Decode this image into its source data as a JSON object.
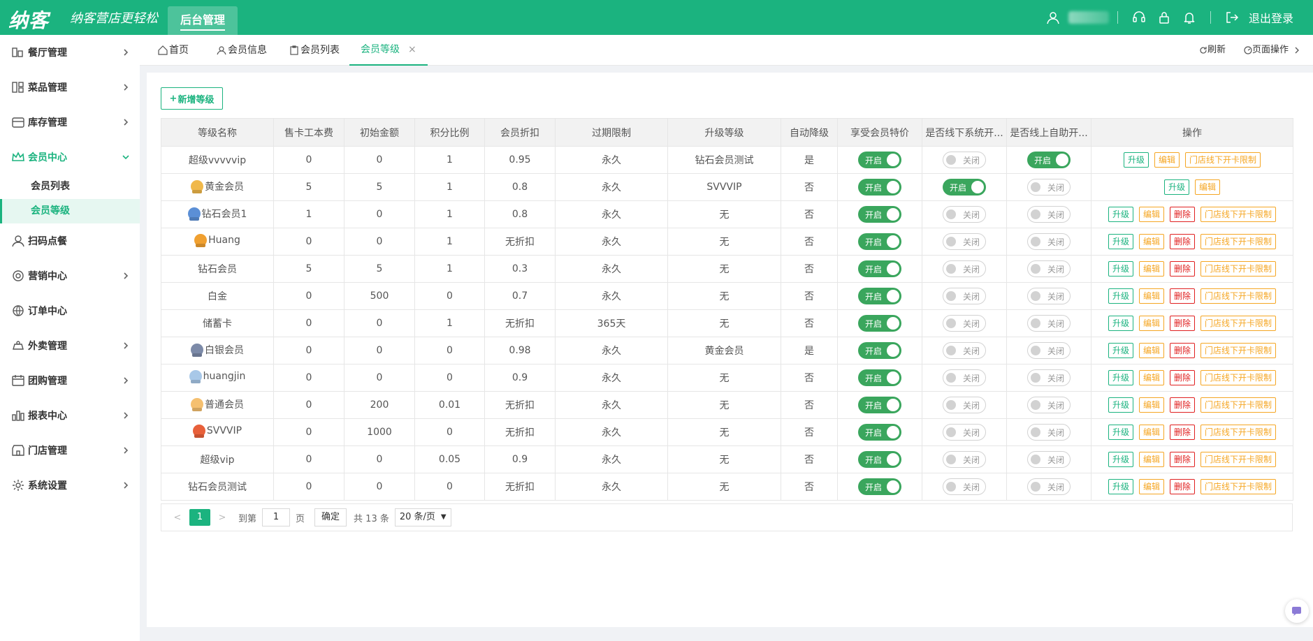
{
  "header": {
    "logo": "纳客",
    "slogan": "纳客营店更轻松",
    "backend_tab": "后台管理",
    "logout": "退出登录"
  },
  "sidebar": {
    "items": [
      {
        "label": "餐厅管理",
        "icon": "restaurant-icon",
        "has_arrow": true
      },
      {
        "label": "菜品管理",
        "icon": "dishes-icon",
        "has_arrow": true
      },
      {
        "label": "库存管理",
        "icon": "inventory-icon",
        "has_arrow": true
      },
      {
        "label": "会员中心",
        "icon": "crown-icon",
        "has_arrow": true,
        "expanded": true
      },
      {
        "label": "扫码点餐",
        "icon": "user-icon",
        "has_arrow": false
      },
      {
        "label": "营销中心",
        "icon": "target-icon",
        "has_arrow": true
      },
      {
        "label": "订单中心",
        "icon": "globe-icon",
        "has_arrow": false
      },
      {
        "label": "外卖管理",
        "icon": "takeout-icon",
        "has_arrow": true
      },
      {
        "label": "团购管理",
        "icon": "calendar-icon",
        "has_arrow": true
      },
      {
        "label": "报表中心",
        "icon": "report-icon",
        "has_arrow": true
      },
      {
        "label": "门店管理",
        "icon": "store-icon",
        "has_arrow": true
      },
      {
        "label": "系统设置",
        "icon": "gear-icon",
        "has_arrow": true
      }
    ],
    "sub_items": [
      {
        "label": "会员列表"
      },
      {
        "label": "会员等级"
      }
    ]
  },
  "tabs": {
    "items": [
      {
        "label": "首页",
        "icon": "home-icon"
      },
      {
        "label": "会员信息",
        "icon": "user-icon"
      },
      {
        "label": "会员列表",
        "icon": "clipboard-icon"
      },
      {
        "label": "会员等级",
        "icon": ""
      }
    ],
    "close_glyph": "×",
    "refresh": "刷新",
    "page_ops": "页面操作"
  },
  "toolbar": {
    "add_label": "新增等级"
  },
  "table": {
    "headers": [
      "等级名称",
      "售卡工本费",
      "初始金额",
      "积分比例",
      "会员折扣",
      "过期限制",
      "升级等级",
      "自动降级",
      "享受会员特价",
      "是否线下系统开...",
      "是否线上自助开...",
      "操作"
    ],
    "on_label": "开启",
    "off_label": "关闭",
    "actions": {
      "upgrade": "升级",
      "edit": "编辑",
      "delete": "删除",
      "limit": "门店线下开卡限制"
    },
    "rows": [
      {
        "name": "超级vvvvvip",
        "medal": "",
        "fee": "0",
        "init": "0",
        "ratio": "1",
        "discount": "0.95",
        "expire": "永久",
        "upgrade": "钻石会员测试",
        "downgrade": "是",
        "special": true,
        "offline": false,
        "online": true,
        "ops": [
          "upgrade",
          "edit",
          "limit"
        ]
      },
      {
        "name": "黄金会员",
        "medal": "#f0b84a",
        "fee": "5",
        "init": "5",
        "ratio": "1",
        "discount": "0.8",
        "expire": "永久",
        "upgrade": "SVVVIP",
        "downgrade": "否",
        "special": true,
        "offline": true,
        "online": false,
        "ops": [
          "upgrade",
          "edit"
        ]
      },
      {
        "name": "钻石会员1",
        "medal": "#5b8fd6",
        "fee": "1",
        "init": "0",
        "ratio": "1",
        "discount": "0.8",
        "expire": "永久",
        "upgrade": "无",
        "downgrade": "否",
        "special": true,
        "offline": false,
        "online": false,
        "ops": [
          "upgrade",
          "edit",
          "delete",
          "limit"
        ]
      },
      {
        "name": "Huang",
        "medal": "#f0a030",
        "fee": "0",
        "init": "0",
        "ratio": "1",
        "discount": "无折扣",
        "expire": "永久",
        "upgrade": "无",
        "downgrade": "否",
        "special": true,
        "offline": false,
        "online": false,
        "ops": [
          "upgrade",
          "edit",
          "delete",
          "limit"
        ]
      },
      {
        "name": "钻石会员",
        "medal": "",
        "fee": "5",
        "init": "5",
        "ratio": "1",
        "discount": "0.3",
        "expire": "永久",
        "upgrade": "无",
        "downgrade": "否",
        "special": true,
        "offline": false,
        "online": false,
        "ops": [
          "upgrade",
          "edit",
          "delete",
          "limit"
        ]
      },
      {
        "name": "白金",
        "medal": "",
        "fee": "0",
        "init": "500",
        "ratio": "0",
        "discount": "0.7",
        "expire": "永久",
        "upgrade": "无",
        "downgrade": "否",
        "special": true,
        "offline": false,
        "online": false,
        "ops": [
          "upgrade",
          "edit",
          "delete",
          "limit"
        ]
      },
      {
        "name": "储蓄卡",
        "medal": "",
        "fee": "0",
        "init": "0",
        "ratio": "1",
        "discount": "无折扣",
        "expire": "365天",
        "upgrade": "无",
        "downgrade": "否",
        "special": true,
        "offline": false,
        "online": false,
        "ops": [
          "upgrade",
          "edit",
          "delete",
          "limit"
        ]
      },
      {
        "name": "白银会员",
        "medal": "#7c8aa8",
        "fee": "0",
        "init": "0",
        "ratio": "0",
        "discount": "0.98",
        "expire": "永久",
        "upgrade": "黄金会员",
        "downgrade": "是",
        "special": true,
        "offline": false,
        "online": false,
        "ops": [
          "upgrade",
          "edit",
          "delete",
          "limit"
        ]
      },
      {
        "name": "huangjin",
        "medal": "#a8c8e8",
        "fee": "0",
        "init": "0",
        "ratio": "0",
        "discount": "0.9",
        "expire": "永久",
        "upgrade": "无",
        "downgrade": "否",
        "special": true,
        "offline": false,
        "online": false,
        "ops": [
          "upgrade",
          "edit",
          "delete",
          "limit"
        ]
      },
      {
        "name": "普通会员",
        "medal": "#f5c070",
        "fee": "0",
        "init": "200",
        "ratio": "0.01",
        "discount": "无折扣",
        "expire": "永久",
        "upgrade": "无",
        "downgrade": "否",
        "special": true,
        "offline": false,
        "online": false,
        "ops": [
          "upgrade",
          "edit",
          "delete",
          "limit"
        ]
      },
      {
        "name": "SVVVIP",
        "medal": "#e8603a",
        "fee": "0",
        "init": "1000",
        "ratio": "0",
        "discount": "无折扣",
        "expire": "永久",
        "upgrade": "无",
        "downgrade": "否",
        "special": true,
        "offline": false,
        "online": false,
        "ops": [
          "upgrade",
          "edit",
          "delete",
          "limit"
        ]
      },
      {
        "name": "超级vip",
        "medal": "",
        "fee": "0",
        "init": "0",
        "ratio": "0.05",
        "discount": "0.9",
        "expire": "永久",
        "upgrade": "无",
        "downgrade": "否",
        "special": true,
        "offline": false,
        "online": false,
        "ops": [
          "upgrade",
          "edit",
          "delete",
          "limit"
        ]
      },
      {
        "name": "钻石会员测试",
        "medal": "",
        "fee": "0",
        "init": "0",
        "ratio": "0",
        "discount": "无折扣",
        "expire": "永久",
        "upgrade": "无",
        "downgrade": "否",
        "special": true,
        "offline": false,
        "online": false,
        "ops": [
          "upgrade",
          "edit",
          "delete",
          "limit"
        ]
      }
    ]
  },
  "pagination": {
    "prev": "<",
    "next": ">",
    "current": "1",
    "goto_label": "到第",
    "goto_value": "1",
    "page_unit": "页",
    "confirm": "确定",
    "total": "共 13 条",
    "page_size": "20 条/页"
  },
  "colors": {
    "brand": "#1bb37f",
    "switch_on": "#3aa65d",
    "delete": "#e02020",
    "edit": "#f5a623"
  }
}
